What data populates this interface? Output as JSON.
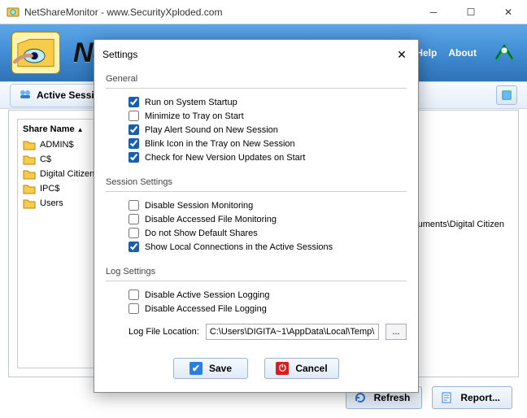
{
  "window": {
    "title": "NetShareMonitor - www.SecurityXploded.com",
    "app_name": "NetShareMonitor"
  },
  "banner": {
    "links": {
      "help": "Show Help",
      "about": "About"
    }
  },
  "toolbar": {
    "active_tab": "Active Sessions"
  },
  "sidebar": {
    "header": "Share Name",
    "items": [
      "ADMIN$",
      "C$",
      "Digital Citizen",
      "IPC$",
      "Users"
    ]
  },
  "detail": {
    "truncated_path": "ocuments\\Digital Citizen"
  },
  "footer": {
    "refresh": "Refresh",
    "report": "Report..."
  },
  "modal": {
    "title": "Settings",
    "groups": {
      "general": {
        "label": "General",
        "options": [
          {
            "label": "Run on System Startup",
            "checked": true
          },
          {
            "label": "Minimize to Tray on Start",
            "checked": false
          },
          {
            "label": "Play Alert Sound on New Session",
            "checked": true
          },
          {
            "label": "Blink Icon in the Tray on New Session",
            "checked": true
          },
          {
            "label": "Check for New Version Updates on Start",
            "checked": true
          }
        ]
      },
      "session": {
        "label": "Session Settings",
        "options": [
          {
            "label": "Disable Session Monitoring",
            "checked": false
          },
          {
            "label": "Disable Accessed File Monitoring",
            "checked": false
          },
          {
            "label": "Do not Show Default Shares",
            "checked": false
          },
          {
            "label": "Show Local Connections in the Active Sessions",
            "checked": true
          }
        ]
      },
      "log": {
        "label": "Log Settings",
        "options": [
          {
            "label": "Disable Active Session Logging",
            "checked": false
          },
          {
            "label": "Disable Accessed File Logging",
            "checked": false
          }
        ],
        "location_label": "Log File Location:",
        "location_value": "C:\\Users\\DIGITA~1\\AppData\\Local\\Temp\\",
        "browse": "..."
      }
    },
    "buttons": {
      "save": "Save",
      "cancel": "Cancel"
    }
  }
}
